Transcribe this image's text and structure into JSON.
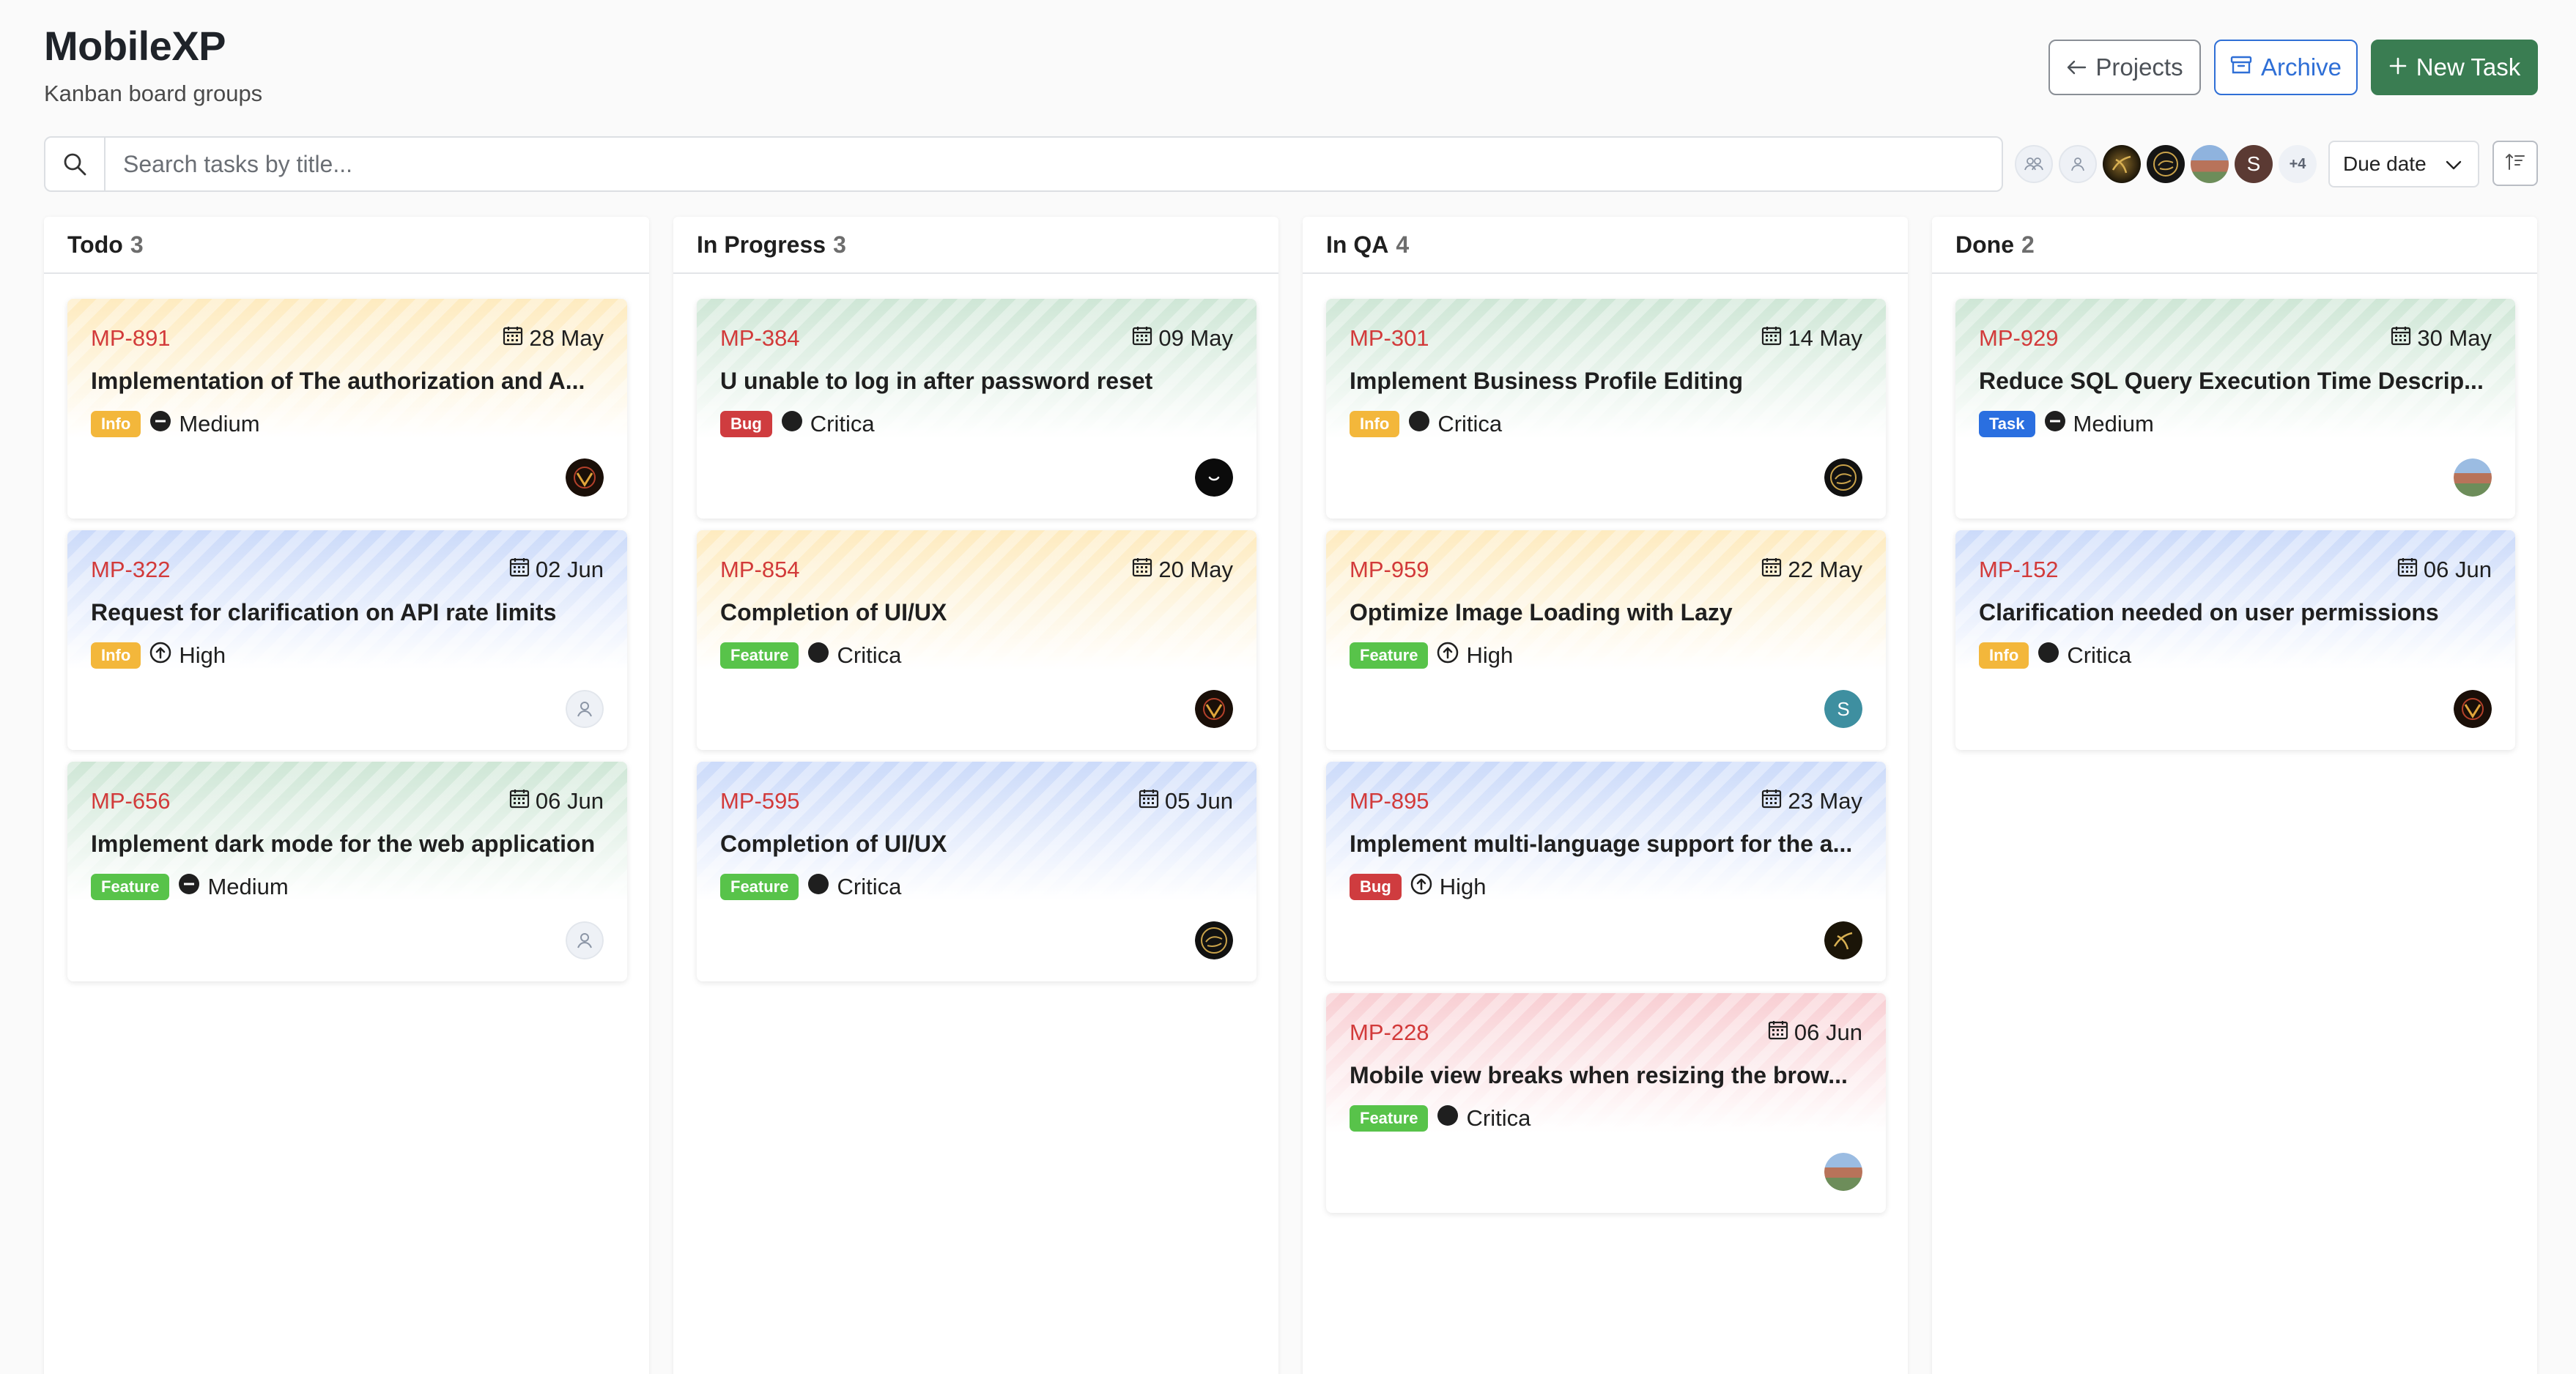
{
  "header": {
    "title": "MobileXP",
    "subtitle": "Kanban board groups",
    "projects_label": "Projects",
    "archive_label": "Archive",
    "new_task_label": "New Task"
  },
  "search": {
    "placeholder": "Search tasks by title...",
    "value": ""
  },
  "filters": {
    "more_count": "+4",
    "avatar_s_initial": "S",
    "sort_label": "Due date"
  },
  "colors": {
    "accent_green": "#3a7d52",
    "accent_blue": "#2f6fd6",
    "id_red": "#d23a3a",
    "tag_info": "#f3b73b",
    "tag_bug": "#cf3c3f",
    "tag_feature": "#58c34a",
    "tag_task": "#2a6fe0"
  },
  "columns": [
    {
      "name": "Todo",
      "count": "3",
      "cards": [
        {
          "id": "MP-891",
          "date": "28 May",
          "title": "Implementation of The authorization and A...",
          "tag": "Info",
          "priority": "Medium",
          "avatar": "gold-emblem"
        },
        {
          "id": "MP-322",
          "date": "02 Jun",
          "title": "Request for clarification on API rate limits",
          "tag": "Info",
          "priority": "High",
          "avatar": "unassigned"
        },
        {
          "id": "MP-656",
          "date": "06 Jun",
          "title": "Implement dark mode for the web application",
          "tag": "Feature",
          "priority": "Medium",
          "avatar": "unassigned"
        }
      ]
    },
    {
      "name": "In Progress",
      "count": "3",
      "cards": [
        {
          "id": "MP-384",
          "date": "09 May",
          "title": "U unable to log in after password reset",
          "tag": "Bug",
          "priority": "Critica",
          "avatar": "black-smile"
        },
        {
          "id": "MP-854",
          "date": "20 May",
          "title": "Completion of UI/UX",
          "tag": "Feature",
          "priority": "Critica",
          "avatar": "gold-emblem"
        },
        {
          "id": "MP-595",
          "date": "05 Jun",
          "title": "Completion of UI/UX",
          "tag": "Feature",
          "priority": "Critica",
          "avatar": "calligraphy"
        }
      ]
    },
    {
      "name": "In QA",
      "count": "4",
      "cards": [
        {
          "id": "MP-301",
          "date": "14 May",
          "title": "Implement Business Profile Editing",
          "tag": "Info",
          "priority": "Critica",
          "avatar": "calligraphy"
        },
        {
          "id": "MP-959",
          "date": "22 May",
          "title": "Optimize Image Loading with Lazy",
          "tag": "Feature",
          "priority": "High",
          "avatar": "letter-s"
        },
        {
          "id": "MP-895",
          "date": "23 May",
          "title": "Implement multi-language support for the a...",
          "tag": "Bug",
          "priority": "High",
          "avatar": "dark-gold"
        },
        {
          "id": "MP-228",
          "date": "06 Jun",
          "title": "Mobile view breaks when resizing the brow...",
          "tag": "Feature",
          "priority": "Critica",
          "avatar": "landscape"
        }
      ]
    },
    {
      "name": "Done",
      "count": "2",
      "cards": [
        {
          "id": "MP-929",
          "date": "30 May",
          "title": "Reduce SQL Query Execution Time Descrip...",
          "tag": "Task",
          "priority": "Medium",
          "avatar": "landscape"
        },
        {
          "id": "MP-152",
          "date": "06 Jun",
          "title": "Clarification needed on user permissions",
          "tag": "Info",
          "priority": "Critica",
          "avatar": "gold-emblem"
        }
      ]
    }
  ]
}
